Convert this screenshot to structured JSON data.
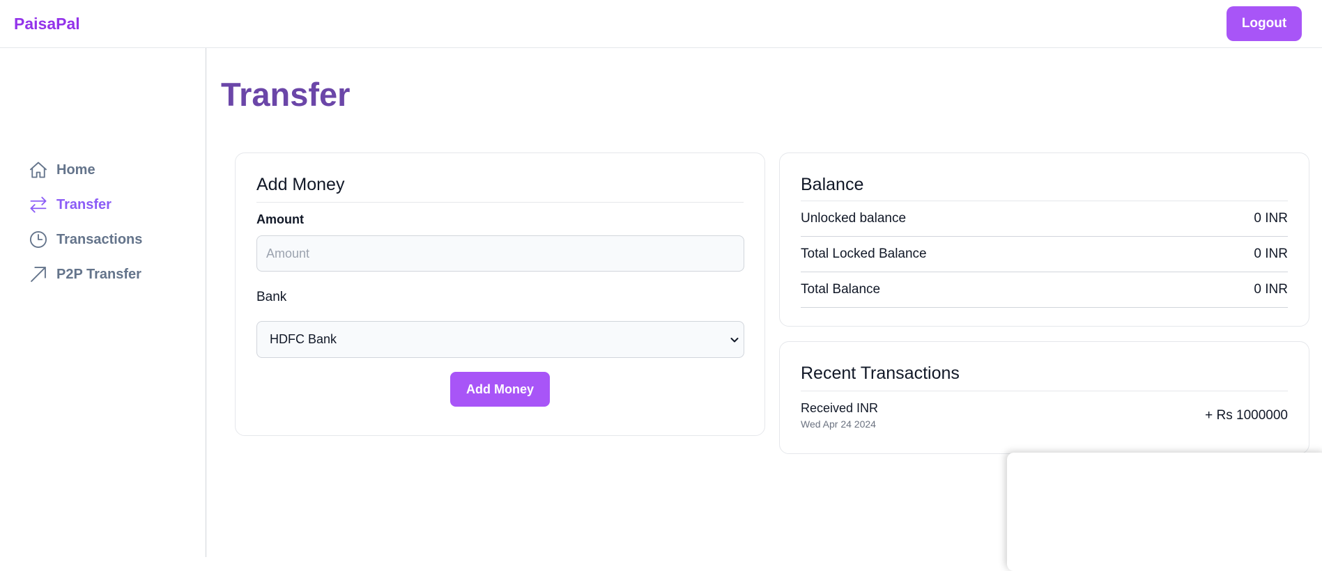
{
  "header": {
    "brand": "PaisaPal",
    "logout_label": "Logout"
  },
  "sidebar": {
    "items": [
      {
        "label": "Home",
        "icon": "home-icon",
        "active": false
      },
      {
        "label": "Transfer",
        "icon": "arrows-right-left-icon",
        "active": true
      },
      {
        "label": "Transactions",
        "icon": "clock-icon",
        "active": false
      },
      {
        "label": "P2P Transfer",
        "icon": "arrow-up-right-icon",
        "active": false
      }
    ]
  },
  "page": {
    "title": "Transfer"
  },
  "add_money": {
    "title": "Add Money",
    "amount_label": "Amount",
    "amount_placeholder": "Amount",
    "amount_value": "",
    "bank_label": "Bank",
    "bank_selected": "HDFC Bank",
    "button_label": "Add Money"
  },
  "balance": {
    "title": "Balance",
    "rows": [
      {
        "label": "Unlocked balance",
        "value": "0 INR"
      },
      {
        "label": "Total Locked Balance",
        "value": "0 INR"
      },
      {
        "label": "Total Balance",
        "value": "0 INR"
      }
    ]
  },
  "recent": {
    "title": "Recent Transactions",
    "items": [
      {
        "title": "Received INR",
        "date": "Wed Apr 24 2024",
        "amount": "+ Rs 1000000"
      }
    ]
  },
  "colors": {
    "brand": "#9333ea",
    "accent_button": "#a855f7",
    "active_nav": "#8b5cf6",
    "page_title": "#6b46a8",
    "nav_text": "#64748b"
  }
}
